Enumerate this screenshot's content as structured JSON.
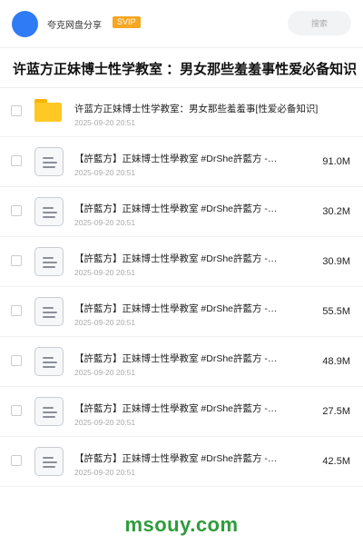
{
  "header": {
    "app_name": "夸克网盘分享",
    "badge": "SVIP",
    "search_placeholder": "搜索"
  },
  "page_title": "许蓝方正妹博士性学教室 ：男女那些羞羞事性爱必备知识",
  "items": [
    {
      "type": "folder",
      "name": "许蓝方正妹博士性学教室：男女那些羞羞事[性爱必备知识]",
      "date": "2025-09-20 20:51",
      "size": ""
    },
    {
      "type": "file",
      "name": "【許藍方】正妹博士性學教室 #DrShe許藍方 -…",
      "date": "2025-09-20 20:51",
      "size": "91.0M"
    },
    {
      "type": "file",
      "name": "【許藍方】正妹博士性學教室 #DrShe許藍方 -…",
      "date": "2025-09-20 20:51",
      "size": "30.2M"
    },
    {
      "type": "file",
      "name": "【許藍方】正妹博士性學教室 #DrShe許藍方 -…",
      "date": "2025-09-20 20:51",
      "size": "30.9M"
    },
    {
      "type": "file",
      "name": "【許藍方】正妹博士性學教室 #DrShe許藍方 -…",
      "date": "2025-09-20 20:51",
      "size": "55.5M"
    },
    {
      "type": "file",
      "name": "【許藍方】正妹博士性學教室 #DrShe許藍方 -…",
      "date": "2025-09-20 20:51",
      "size": "48.9M"
    },
    {
      "type": "file",
      "name": "【許藍方】正妹博士性學教室 #DrShe許藍方 -…",
      "date": "2025-09-20 20:51",
      "size": "27.5M"
    },
    {
      "type": "file",
      "name": "【許藍方】正妹博士性學教室 #DrShe許藍方 -…",
      "date": "2025-09-20 20:51",
      "size": "42.5M"
    }
  ],
  "watermark": "msouy.com",
  "colors": {
    "accent_blue": "#2f7bf5",
    "svip_orange": "#f5a623",
    "folder_yellow": "#ffc823",
    "watermark_green": "#2e9c3a"
  }
}
